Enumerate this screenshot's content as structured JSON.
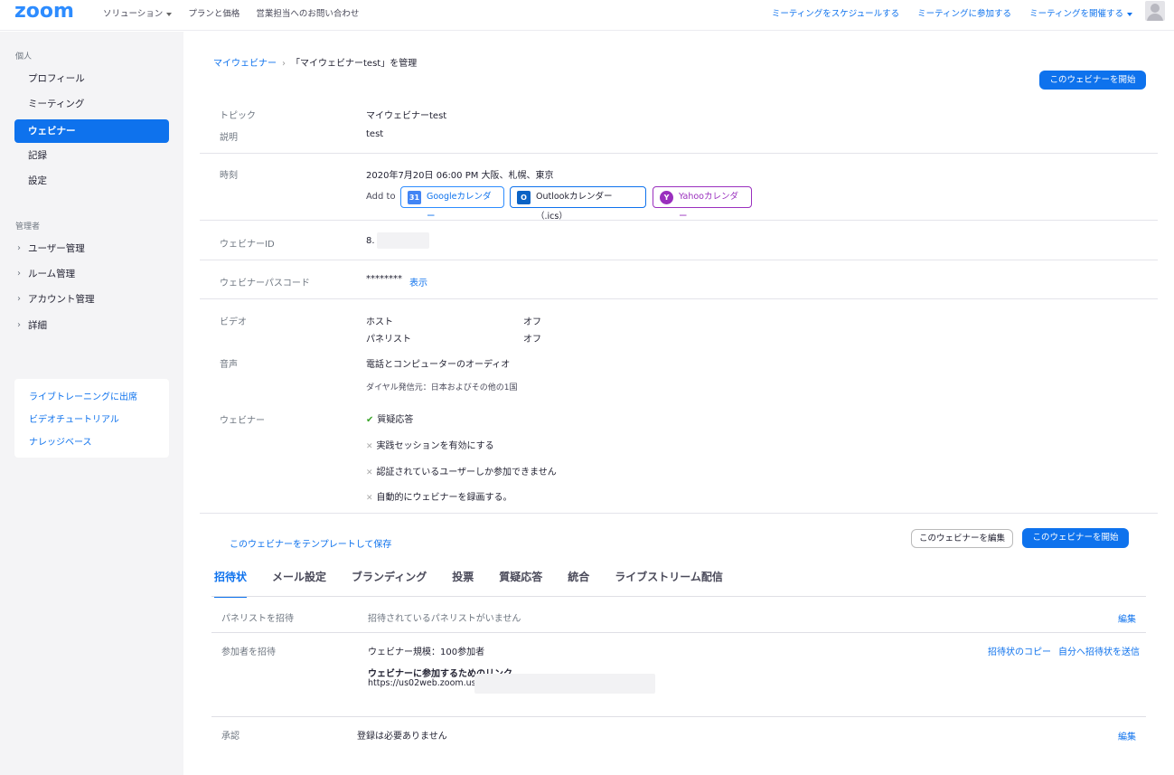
{
  "topnav": {
    "logo": "zoom",
    "left": [
      "ソリューション",
      "プランと価格",
      "営業担当へのお問い合わせ"
    ],
    "right": [
      "ミーティングをスケジュールする",
      "ミーティングに参加する",
      "ミーティングを開催する"
    ]
  },
  "sidebar": {
    "personal_heading": "個人",
    "personal_items": [
      "プロフィール",
      "ミーティング",
      "ウェビナー",
      "記録",
      "設定"
    ],
    "admin_heading": "管理者",
    "admin_items": [
      "ユーザー管理",
      "ルーム管理",
      "アカウント管理",
      "詳細"
    ],
    "links": [
      "ライブトレーニングに出席",
      "ビデオチュートリアル",
      "ナレッジベース"
    ]
  },
  "breadcrumb": {
    "parent": "マイウェビナー",
    "current": "「マイウェビナーtest」を管理"
  },
  "start_button": "このウェビナーを開始",
  "details": {
    "topic_label": "トピック",
    "topic": "マイウェビナーtest",
    "desc_label": "説明",
    "desc": "test",
    "time_label": "時刻",
    "time": "2020年7月20日 06:00 PM 大阪、札幌、東京",
    "add_to": "Add to",
    "google": "Googleカレンダー",
    "outlook": "Outlookカレンダー（.ics）",
    "yahoo": "Yahooカレンダー",
    "id_label": "ウェビナーID",
    "id_value": "8.",
    "pass_label": "ウェビナーパスコード",
    "pass_value": "********",
    "show": "表示",
    "video_label": "ビデオ",
    "host": "ホスト",
    "host_val": "オフ",
    "panelist": "パネリスト",
    "panelist_val": "オフ",
    "audio_label": "音声",
    "audio": "電話とコンピューターのオーディオ",
    "dial": "ダイヤル発信元：日本およびその他の1国",
    "webinar_label": "ウェビナー",
    "options": [
      "質疑応答",
      "実践セッションを有効にする",
      "認証されているユーザーしか参加できません",
      "自動的にウェビナーを録画する。"
    ]
  },
  "save_template": "このウェビナーをテンプレートして保存",
  "edit_button": "このウェビナーを編集",
  "tabs": [
    "招待状",
    "メール設定",
    "ブランディング",
    "投票",
    "質疑応答",
    "統合",
    "ライブストリーム配信"
  ],
  "invite": {
    "panelist_label": "パネリストを招待",
    "panelist_val": "招待されているパネリストがいません",
    "edit": "編集",
    "attendee_label": "参加者を招待",
    "size": "ウェビナー規模：100参加者",
    "copy": "招待状のコピー",
    "send": "自分へ招待状を送信",
    "link_title": "ウェビナーに参加するためのリンク",
    "link": "https://us02web.zoom.us/j/",
    "approval_label": "承認",
    "approval_val": "登録は必要ありません"
  },
  "colors": {
    "accent": "#0e72ed",
    "brand": "#2d8cff",
    "yahoo": "#9a2fbe"
  }
}
